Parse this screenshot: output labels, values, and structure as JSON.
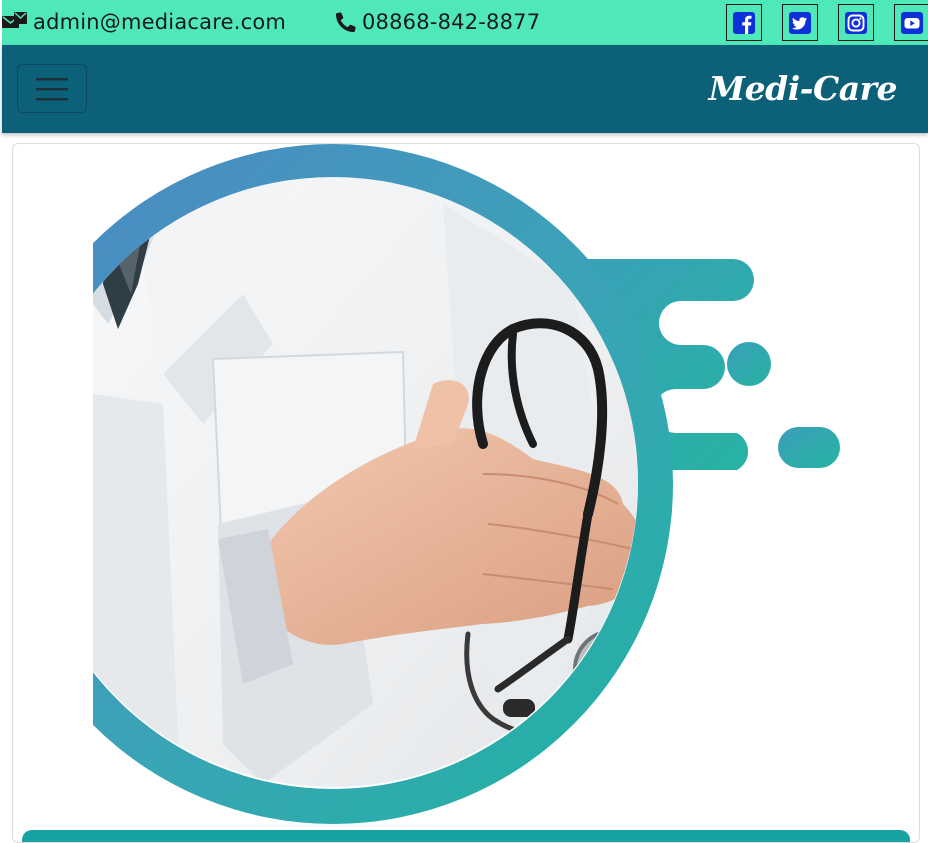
{
  "topbar": {
    "email": "admin@mediacare.com",
    "phone": "08868-842-8877",
    "email_icon": "envelope-icon",
    "phone_icon": "phone-icon",
    "social": [
      {
        "name": "facebook",
        "icon": "facebook-square-icon"
      },
      {
        "name": "twitter",
        "icon": "twitter-square-icon"
      },
      {
        "name": "instagram",
        "icon": "instagram-icon"
      },
      {
        "name": "youtube",
        "icon": "youtube-square-icon"
      }
    ],
    "colors": {
      "background": "#4fe9b9",
      "icon": "#0f2fd9",
      "text": "#1a1a1a"
    }
  },
  "navbar": {
    "brand": "Medi-Care",
    "toggler_icon": "hamburger-menu-icon",
    "colors": {
      "background": "#0c6078",
      "brand_text": "#ffffff"
    }
  },
  "hero": {
    "image": "doctor-with-stethoscope-illustration",
    "accent_color": "#2aa9a6"
  }
}
